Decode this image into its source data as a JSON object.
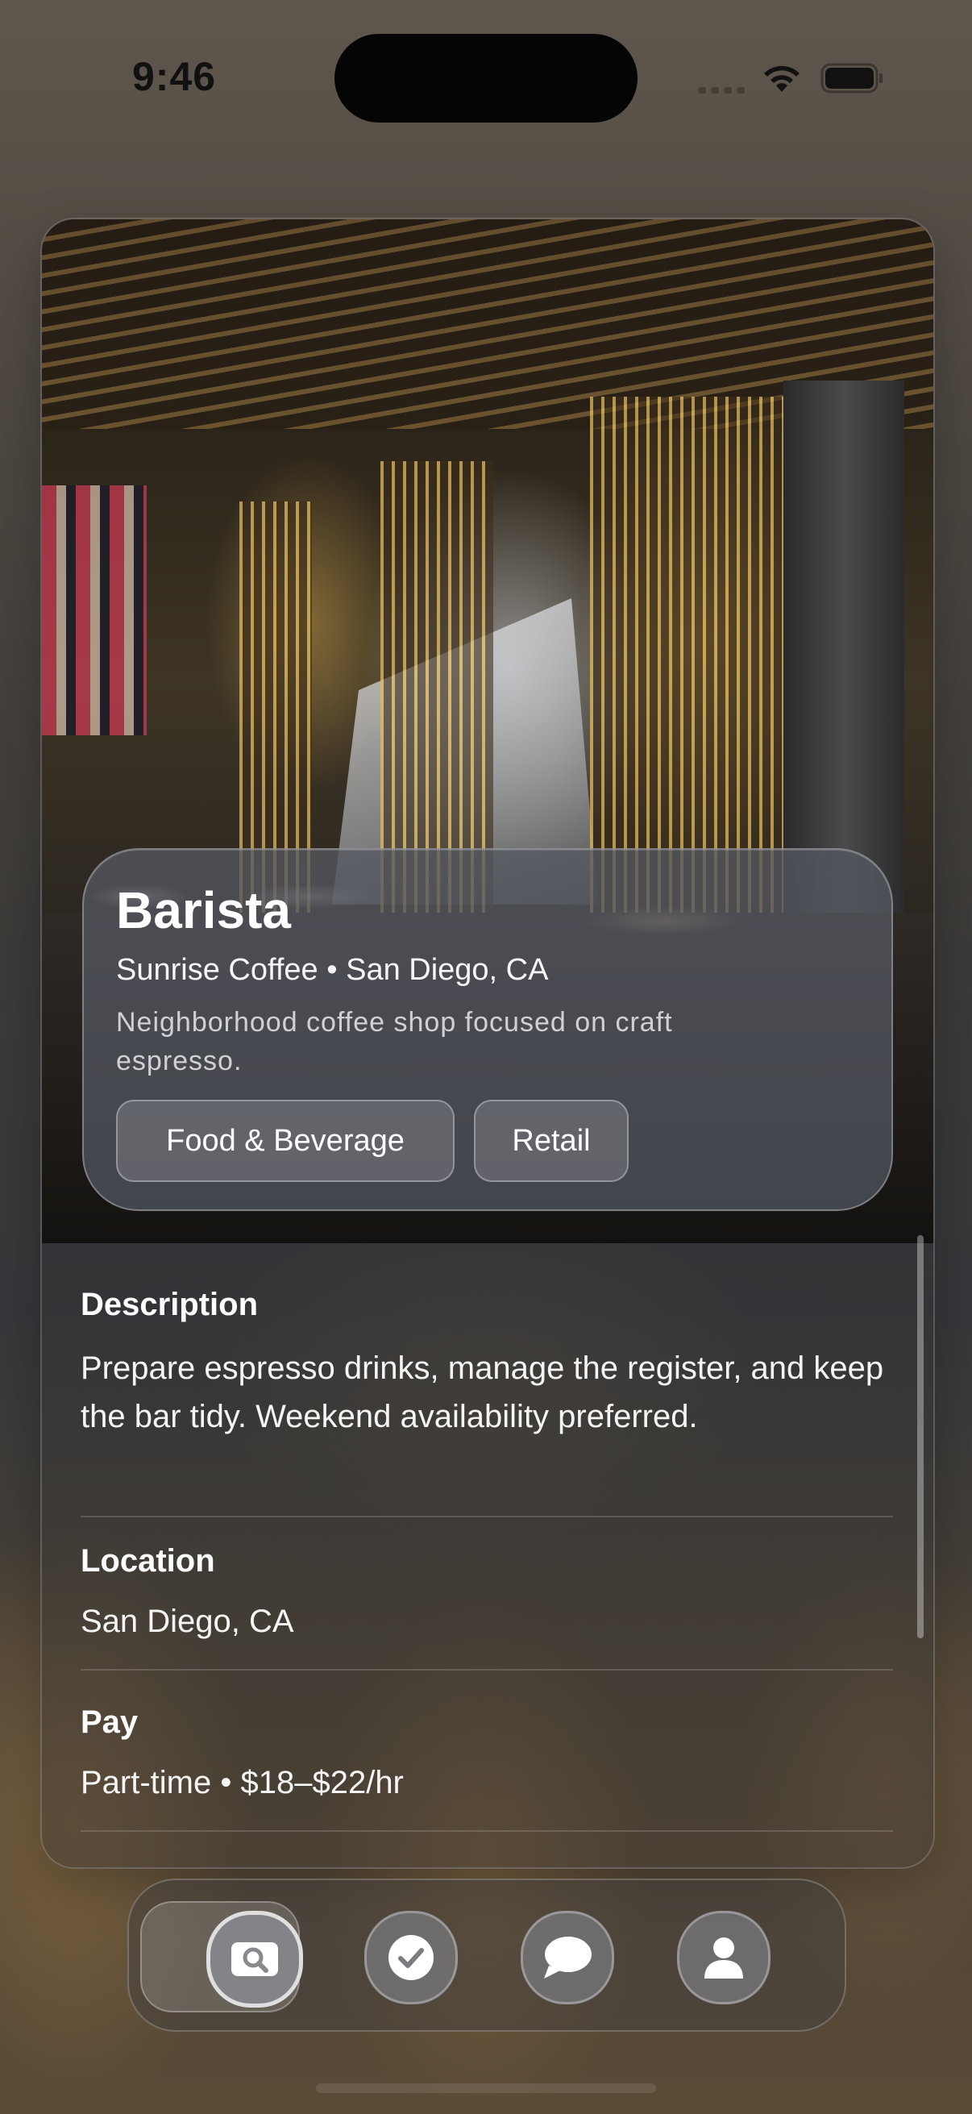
{
  "status_bar": {
    "time": "9:46",
    "icons": [
      "signal-icon",
      "wifi-icon",
      "battery-icon"
    ]
  },
  "job": {
    "title": "Barista",
    "subtitle": "Sunrise Coffee • San Diego, CA",
    "tagline": "Neighborhood coffee shop focused on craft espresso.",
    "hero_image": "restaurant-interior-photo",
    "tags": [
      "Food & Beverage",
      "Retail"
    ]
  },
  "details": {
    "description": {
      "heading": "Description",
      "body": "Prepare espresso drinks, manage the register, and keep the bar tidy. Weekend availability preferred."
    },
    "location": {
      "heading": "Location",
      "body": "San Diego, CA"
    },
    "pay": {
      "heading": "Pay",
      "body": "Part-time • $18–$22/hr"
    }
  },
  "tab_bar": {
    "selected": "search",
    "tabs": [
      {
        "id": "search",
        "icon": "search-icon"
      },
      {
        "id": "applied",
        "icon": "checkmark-icon"
      },
      {
        "id": "messages",
        "icon": "chat-bubble-icon"
      },
      {
        "id": "profile",
        "icon": "person-icon"
      }
    ]
  },
  "colors": {
    "text": "#ffffff",
    "glass_panel": "#555860",
    "active_tab_ring": "#e8e8e8"
  }
}
